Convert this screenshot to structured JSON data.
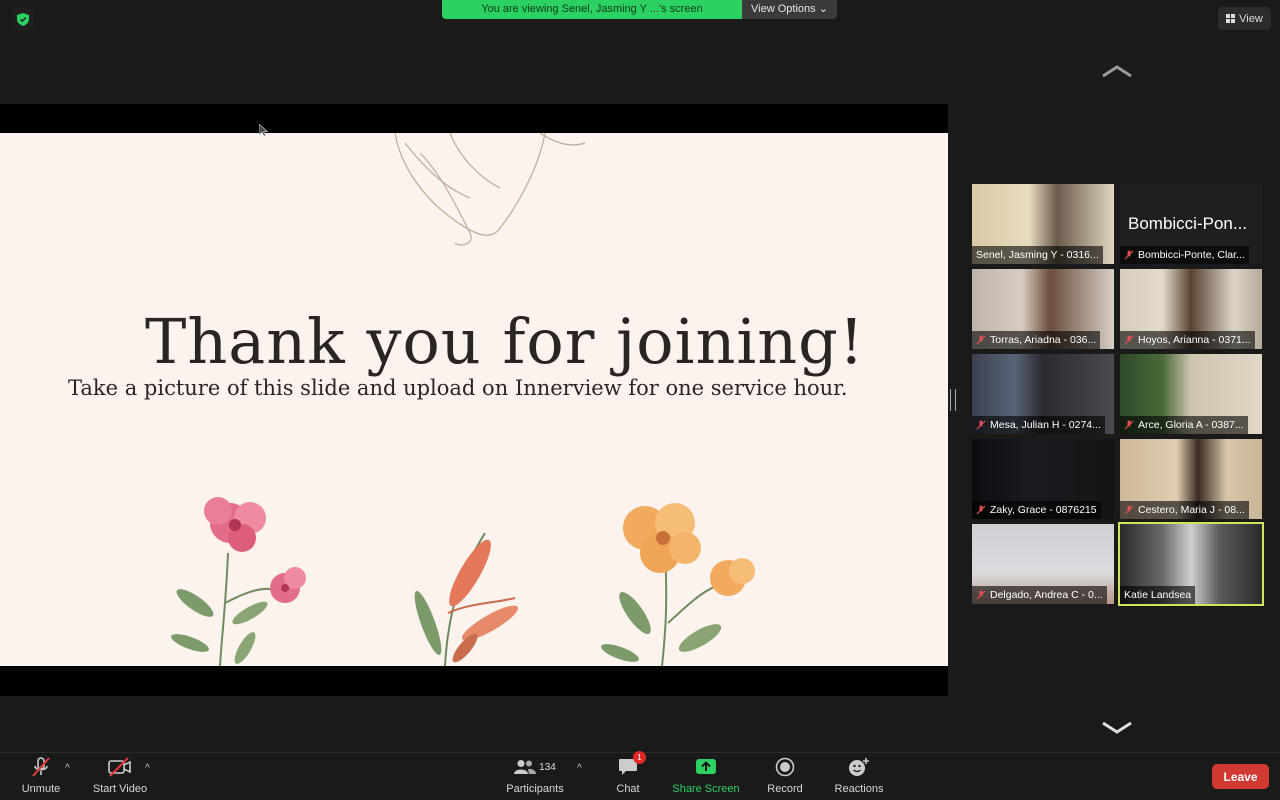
{
  "banner": {
    "viewing_text": "You are viewing Senel, Jasming Y ...'s screen",
    "view_options_label": "View Options",
    "view_label": "View"
  },
  "slide": {
    "title": "Thank you for joining!",
    "subtitle": "Take a picture of this slide and upload on Innerview for one service hour."
  },
  "gallery": {
    "participants": [
      {
        "name": "Senel, Jasming Y - 0316...",
        "muted": false
      },
      {
        "name": "Bombicci-Ponte, Clar...",
        "muted": true,
        "display_name": "Bombicci-Pon..."
      },
      {
        "name": "Torras, Ariadna - 036...",
        "muted": true
      },
      {
        "name": "Hoyos, Arianna - 0371...",
        "muted": true
      },
      {
        "name": "Mesa, Julian H - 0274...",
        "muted": true
      },
      {
        "name": "Arce, Gloria A - 0387...",
        "muted": true
      },
      {
        "name": "Zaky, Grace - 0876215",
        "muted": true
      },
      {
        "name": "Cestero, Maria J - 08...",
        "muted": true
      },
      {
        "name": "Delgado, Andrea C - 0...",
        "muted": true
      },
      {
        "name": "Katie Landsea",
        "muted": false,
        "active_speaker": true
      }
    ]
  },
  "toolbar": {
    "unmute_label": "Unmute",
    "start_video_label": "Start Video",
    "participants_label": "Participants",
    "participants_count": "134",
    "chat_label": "Chat",
    "chat_badge": "1",
    "share_screen_label": "Share Screen",
    "record_label": "Record",
    "reactions_label": "Reactions",
    "leave_label": "Leave"
  },
  "colors": {
    "share_green": "#2bd161",
    "leave_red": "#d13a30",
    "active_speaker": "#d4e35c",
    "slide_bg": "#fcf3ef"
  }
}
